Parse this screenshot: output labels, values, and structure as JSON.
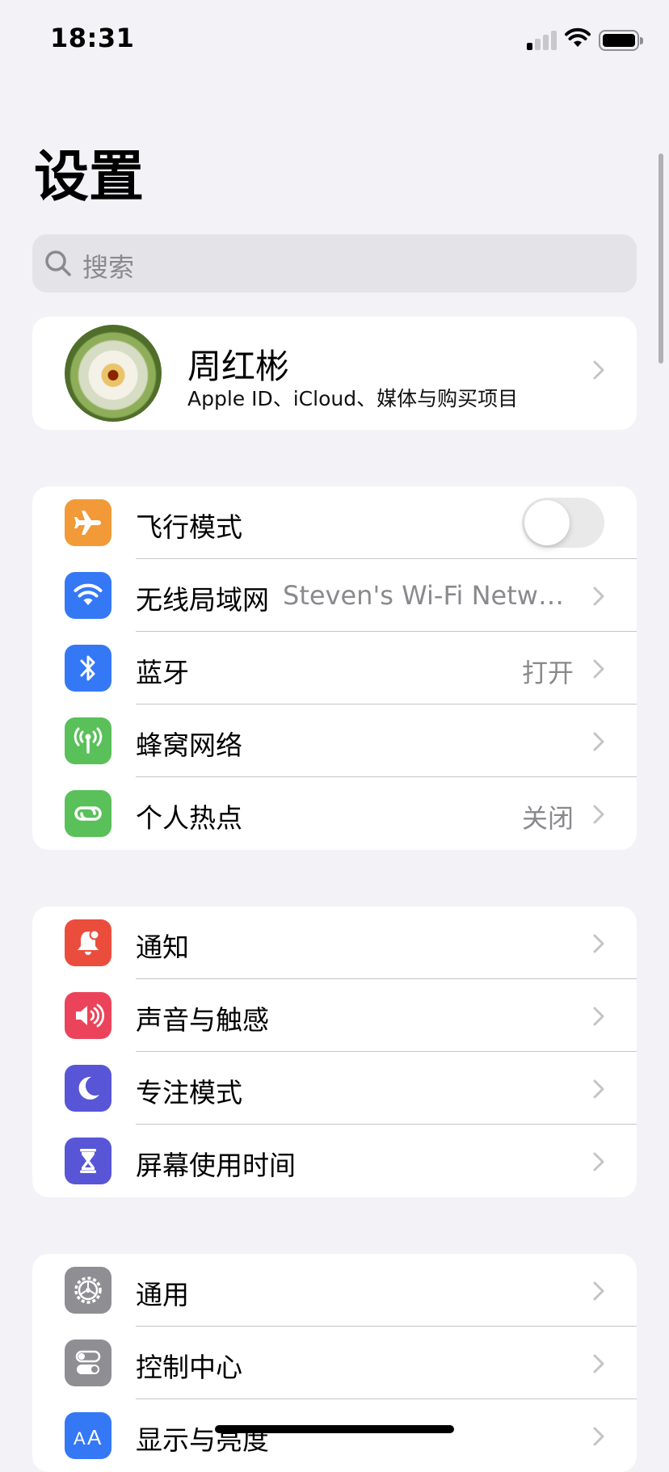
{
  "status_bar": {
    "time": "18:31"
  },
  "header": {
    "title": "设置"
  },
  "search": {
    "placeholder": "搜索"
  },
  "profile": {
    "name": "周红彬",
    "subtitle": "Apple ID、iCloud、媒体与购买项目"
  },
  "connectivity": {
    "items": [
      {
        "label": "飞行模式",
        "icon": "airplane-icon",
        "color": "#f29a38",
        "toggle": false
      },
      {
        "label": "无线局域网",
        "value": "Steven's Wi-Fi Netwo...",
        "icon": "wifi-icon",
        "color": "#3478f6"
      },
      {
        "label": "蓝牙",
        "value": "打开",
        "icon": "bluetooth-icon",
        "color": "#3478f6"
      },
      {
        "label": "蜂窝网络",
        "icon": "antenna-icon",
        "color": "#5ac05a"
      },
      {
        "label": "个人热点",
        "value": "关闭",
        "icon": "hotspot-icon",
        "color": "#5ac05a"
      }
    ]
  },
  "notifications": {
    "items": [
      {
        "label": "通知",
        "icon": "bell-icon",
        "color": "#eb4d3d"
      },
      {
        "label": "声音与触感",
        "icon": "speaker-icon",
        "color": "#eb445a"
      },
      {
        "label": "专注模式",
        "icon": "moon-icon",
        "color": "#5856d6"
      },
      {
        "label": "屏幕使用时间",
        "icon": "hourglass-icon",
        "color": "#5856d6"
      }
    ]
  },
  "general": {
    "items": [
      {
        "label": "通用",
        "icon": "gear-icon",
        "color": "#8e8e93"
      },
      {
        "label": "控制中心",
        "icon": "switches-icon",
        "color": "#8e8e93"
      },
      {
        "label": "显示与亮度",
        "icon": "text-size-icon",
        "color": "#3478f6"
      }
    ]
  }
}
